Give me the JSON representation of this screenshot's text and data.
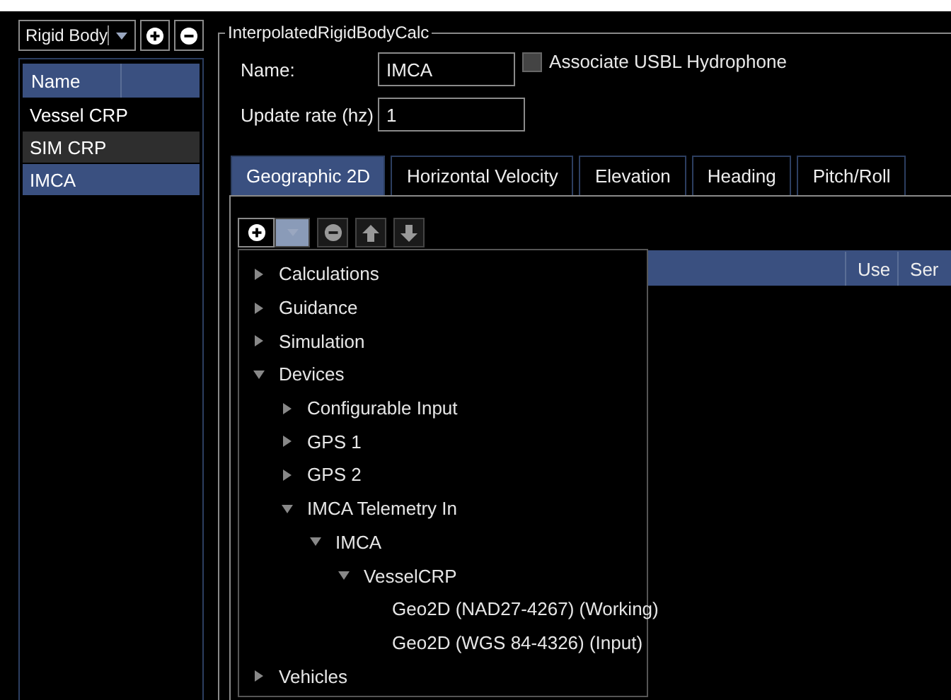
{
  "left_panel": {
    "type_selector": {
      "value": "Rigid Body"
    },
    "list": {
      "columns": [
        "Name"
      ],
      "rows": [
        {
          "name": "Vessel CRP",
          "selected": false,
          "hovered": false
        },
        {
          "name": "SIM CRP",
          "selected": false,
          "hovered": true
        },
        {
          "name": "IMCA",
          "selected": true,
          "hovered": false
        }
      ]
    }
  },
  "group": {
    "title": "InterpolatedRigidBodyCalc",
    "fields": [
      {
        "label": "Name:",
        "value": "IMCA"
      },
      {
        "label": "Update rate (hz)",
        "value": "1"
      }
    ],
    "checkbox": {
      "label": "Associate USBL Hydrophone",
      "checked": false
    },
    "tabs": [
      {
        "label": "Geographic 2D",
        "selected": true
      },
      {
        "label": "Horizontal Velocity",
        "selected": false
      },
      {
        "label": "Elevation",
        "selected": false
      },
      {
        "label": "Heading",
        "selected": false
      },
      {
        "label": "Pitch/Roll",
        "selected": false
      }
    ],
    "toolbar": [
      {
        "kind": "add"
      },
      {
        "kind": "dropdown",
        "open": true
      },
      {
        "kind": "remove"
      },
      {
        "kind": "up"
      },
      {
        "kind": "down"
      }
    ],
    "grid": {
      "columns": [
        "",
        "Use",
        "Ser"
      ]
    },
    "add_menu": {
      "items": [
        {
          "label": "Calculations",
          "expanded": false
        },
        {
          "label": "Guidance",
          "expanded": false
        },
        {
          "label": "Simulation",
          "expanded": false
        },
        {
          "label": "Devices",
          "expanded": true,
          "children": [
            {
              "label": "Configurable Input",
              "expanded": false
            },
            {
              "label": "GPS 1",
              "expanded": false
            },
            {
              "label": "GPS 2",
              "expanded": false
            },
            {
              "label": "IMCA Telemetry In",
              "expanded": true,
              "children": [
                {
                  "label": "IMCA",
                  "expanded": true,
                  "children": [
                    {
                      "label": "VesselCRP",
                      "expanded": true,
                      "children": [
                        {
                          "label": "Geo2D (NAD27-4267) (Working)"
                        },
                        {
                          "label": "Geo2D (WGS 84-4326) (Input)"
                        }
                      ]
                    }
                  ]
                }
              ]
            }
          ]
        },
        {
          "label": "Vehicles",
          "expanded": false
        }
      ]
    }
  }
}
